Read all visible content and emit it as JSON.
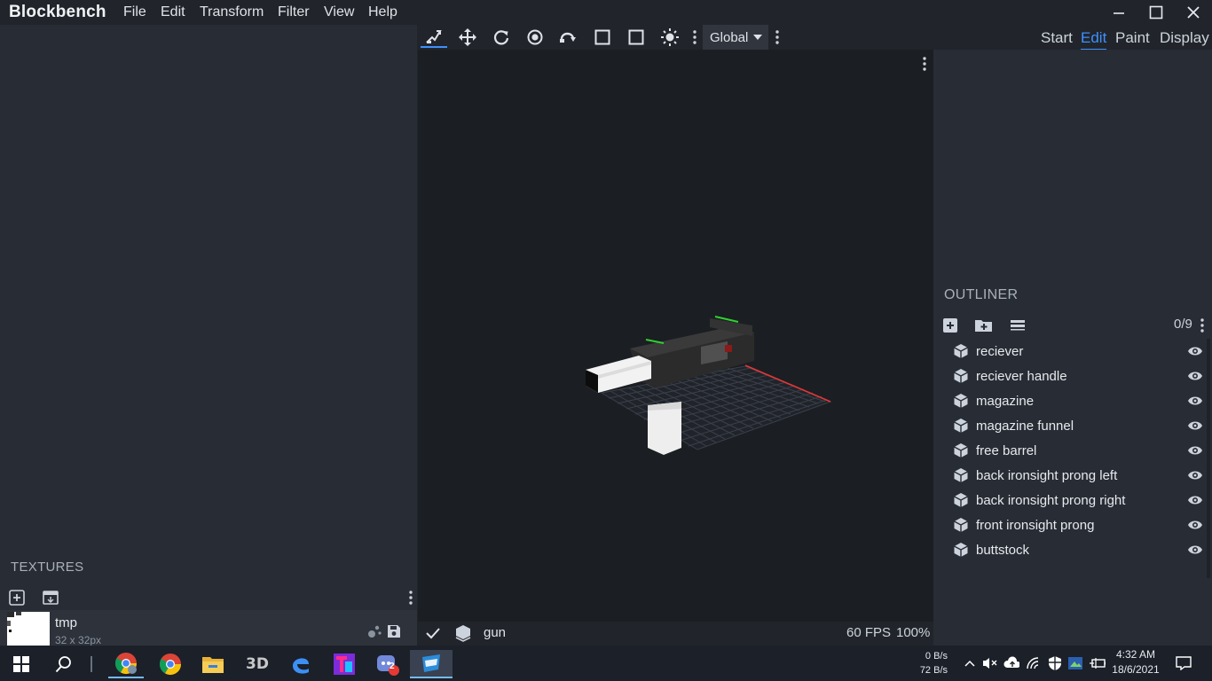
{
  "app": {
    "title": "Blockbench"
  },
  "menu": [
    "File",
    "Edit",
    "Transform",
    "Filter",
    "View",
    "Help"
  ],
  "window_controls": [
    "minimize-icon",
    "maximize-icon",
    "close-icon"
  ],
  "toolbar": {
    "tools": [
      "move-tool-icon",
      "move-arrows-icon",
      "rotate-icon",
      "pivot-icon",
      "vertex-snap-icon",
      "resize-icon",
      "box-select-icon",
      "lighting-icon"
    ],
    "space_select": "Global"
  },
  "modes": {
    "start": "Start",
    "edit": "Edit",
    "paint": "Paint",
    "display": "Display",
    "active": "Edit"
  },
  "textures": {
    "header": "TEXTURES",
    "items": [
      {
        "name": "tmp",
        "size": "32 x 32px"
      }
    ]
  },
  "outliner": {
    "header": "OUTLINER",
    "count": "0/9",
    "items": [
      {
        "label": "reciever"
      },
      {
        "label": "reciever handle"
      },
      {
        "label": "magazine"
      },
      {
        "label": "magazine funnel"
      },
      {
        "label": "free barrel"
      },
      {
        "label": "back ironsight prong left"
      },
      {
        "label": "back ironsight prong right"
      },
      {
        "label": "front ironsight prong"
      },
      {
        "label": "buttstock"
      }
    ]
  },
  "viewport": {
    "model_name": "gun",
    "fps": "60 FPS",
    "zoom": "100%"
  },
  "taskbar": {
    "apps": [
      "start-icon",
      "search-icon",
      "chrome-icon",
      "chrome-icon",
      "file-explorer-icon",
      "3d-viewer-icon",
      "edge-icon",
      "app-icon",
      "discord-icon",
      "blockbench-icon"
    ],
    "discord_badge": "2",
    "net_up": "0 B/s",
    "net_down": "72 B/s",
    "time": "4:32 AM",
    "date": "18/6/2021"
  },
  "colors": {
    "accent": "#3e90ff",
    "panel": "#282c34",
    "viewport": "#1b1e23"
  }
}
